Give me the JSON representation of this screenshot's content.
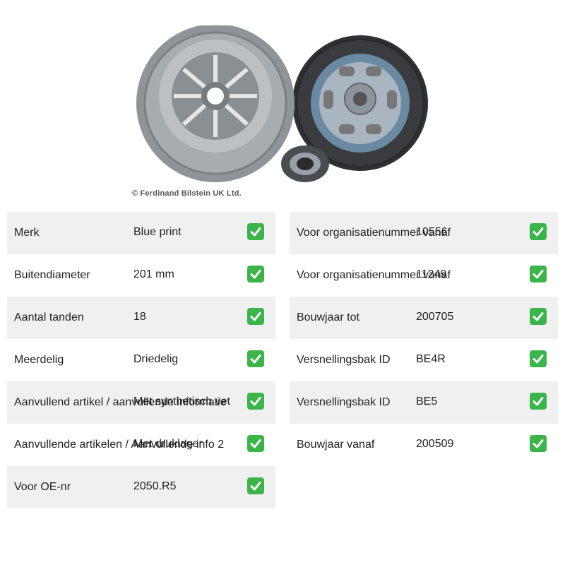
{
  "image": {
    "alt": "product-photo-clutch-kit",
    "copyright": "© Ferdinand Bilstein UK Ltd."
  },
  "colors": {
    "check": "#3bb54a",
    "row_shade": "#f0f0f0"
  },
  "left_rows": [
    {
      "label": "Merk",
      "value": "Blue print"
    },
    {
      "label": "Buitendiameter",
      "value": "201 mm"
    },
    {
      "label": "Aantal tanden",
      "value": "18"
    },
    {
      "label": "Meerdelig",
      "value": "Driedelig"
    },
    {
      "label": "Aanvullend artikel / aanvullende informatie",
      "value": "Met synthetisch vet"
    },
    {
      "label": "Aanvullende artikelen / Aanvullende info 2",
      "value": "Met druklager"
    },
    {
      "label": "Voor OE-nr",
      "value": "2050.R5"
    }
  ],
  "right_rows": [
    {
      "label": "Voor organisatienummer vanaf",
      "value": "10556"
    },
    {
      "label": "Voor organisatienummer vanaf",
      "value": "11249"
    },
    {
      "label": "Bouwjaar tot",
      "value": "200705"
    },
    {
      "label": "Versnellingsbak ID",
      "value": "BE4R"
    },
    {
      "label": "Versnellingsbak ID",
      "value": "BE5"
    },
    {
      "label": "Bouwjaar vanaf",
      "value": "200509"
    }
  ],
  "check_icon": "check-mark-icon"
}
